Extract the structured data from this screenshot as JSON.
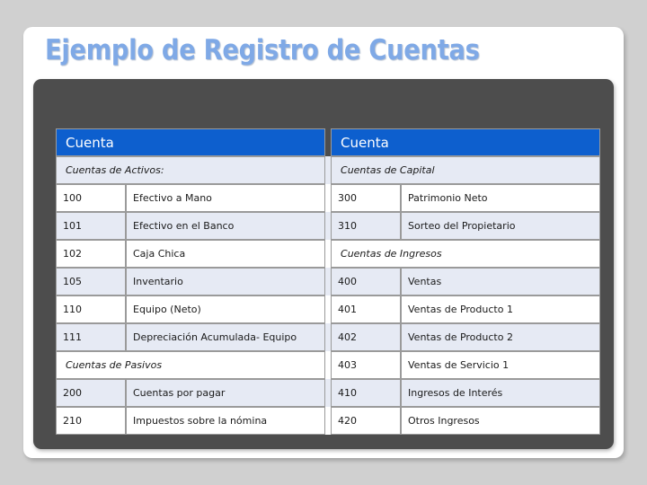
{
  "slide": {
    "title": "Ejemplo de Registro de Cuentas",
    "title_color": "#7fa9e6",
    "panel_color": "#4d4d4d",
    "header_color": "#0d5fce",
    "alt_row_color": "#e6eaf4"
  },
  "table": {
    "headers": {
      "left": "Cuenta",
      "right": "Cuenta"
    },
    "rows": [
      {
        "left": {
          "kind": "section",
          "label": "Cuentas de Activos:"
        },
        "right": {
          "kind": "section",
          "label": "Cuentas de Capital"
        },
        "shade": "alt"
      },
      {
        "left": {
          "kind": "entry",
          "code": "100",
          "name": "Efectivo a Mano"
        },
        "right": {
          "kind": "entry",
          "code": "300",
          "name": "Patrimonio Neto"
        },
        "shade": "plain"
      },
      {
        "left": {
          "kind": "entry",
          "code": "101",
          "name": "Efectivo en el Banco"
        },
        "right": {
          "kind": "entry",
          "code": "310",
          "name": "Sorteo del Propietario"
        },
        "shade": "alt"
      },
      {
        "left": {
          "kind": "entry",
          "code": "102",
          "name": "Caja Chica"
        },
        "right": {
          "kind": "section",
          "label": "Cuentas de Ingresos"
        },
        "shade": "plain"
      },
      {
        "left": {
          "kind": "entry",
          "code": "105",
          "name": "Inventario"
        },
        "right": {
          "kind": "entry",
          "code": "400",
          "name": "Ventas"
        },
        "shade": "alt"
      },
      {
        "left": {
          "kind": "entry",
          "code": "110",
          "name": "Equipo (Neto)"
        },
        "right": {
          "kind": "entry",
          "code": "401",
          "name": "Ventas de Producto 1"
        },
        "shade": "plain"
      },
      {
        "left": {
          "kind": "entry",
          "code": "111",
          "name": "Depreciación Acumulada- Equipo"
        },
        "right": {
          "kind": "entry",
          "code": "402",
          "name": "Ventas de Producto 2"
        },
        "shade": "alt"
      },
      {
        "left": {
          "kind": "section",
          "label": "Cuentas de Pasivos"
        },
        "right": {
          "kind": "entry",
          "code": "403",
          "name": "Ventas de Servicio 1"
        },
        "shade": "plain"
      },
      {
        "left": {
          "kind": "entry",
          "code": "200",
          "name": "Cuentas por pagar"
        },
        "right": {
          "kind": "entry",
          "code": "410",
          "name": "Ingresos de Interés"
        },
        "shade": "alt"
      },
      {
        "left": {
          "kind": "entry",
          "code": "210",
          "name": "Impuestos sobre la nómina"
        },
        "right": {
          "kind": "entry",
          "code": "420",
          "name": "Otros Ingresos"
        },
        "shade": "plain"
      }
    ]
  }
}
